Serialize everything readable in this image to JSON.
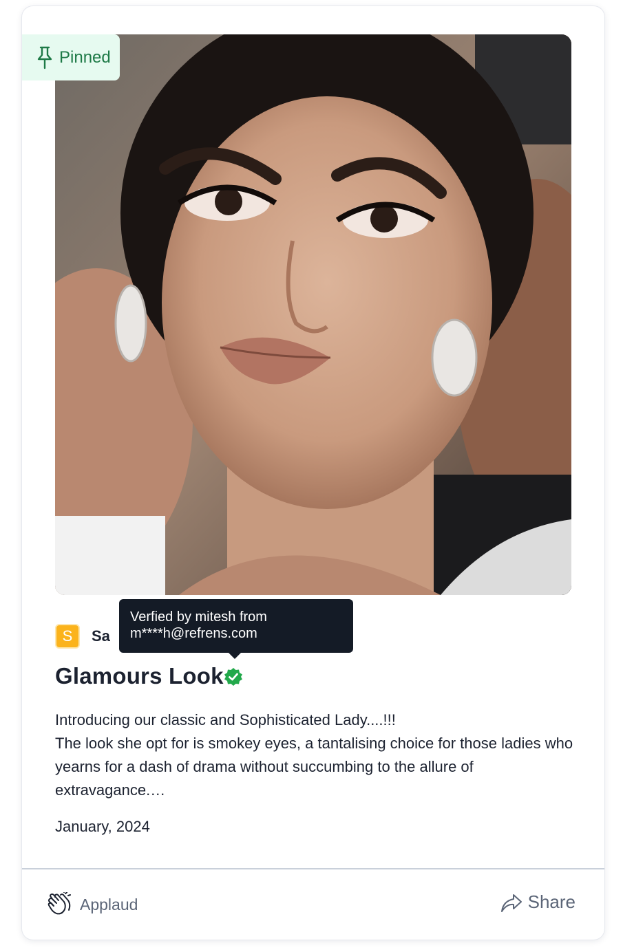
{
  "post": {
    "pinned_label": "Pinned",
    "author_initial": "S",
    "author_name_visible": "Sa",
    "title": "Glamours Look",
    "description_lines": [
      "Introducing our classic and Sophisticated Lady....!!!",
      "The look she opt for is smokey eyes, a tantalising choice for those ladies who yearns for a dash of drama without succumbing to the allure of extravagance.…"
    ],
    "date": "January, 2024"
  },
  "tooltip": {
    "text_line1": "Verfied by mitesh from",
    "text_line2": "m****h@refrens.com"
  },
  "actions": {
    "applaud_label": "Applaud",
    "share_label": "Share"
  },
  "icons": {
    "pinned": "pin-icon",
    "verified": "verified-check-icon",
    "applaud": "clapping-hands-icon",
    "share": "share-arrow-icon"
  },
  "colors": {
    "pinned_bg": "#e6faf0",
    "pinned_text": "#1e7a47",
    "verified_green": "#22a94b",
    "avatar_bg": "#fbb31c",
    "tooltip_bg": "#141b26",
    "muted_text": "#5b6577"
  }
}
